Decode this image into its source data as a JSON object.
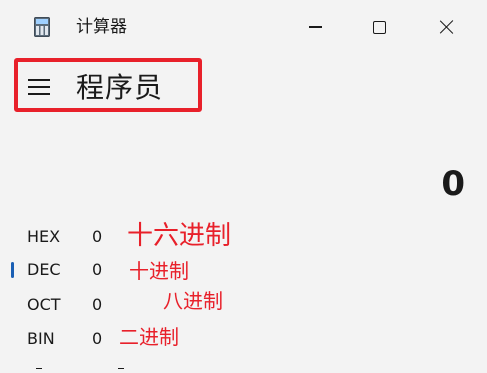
{
  "window": {
    "title": "计算器",
    "icon": "calculator-icon"
  },
  "controls": {
    "minimize_icon": "minimize-icon",
    "maximize_icon": "maximize-icon",
    "close_icon": "close-icon"
  },
  "header": {
    "menu_icon": "hamburger-menu-icon",
    "mode": "程序员",
    "highlight_color": "#e8202a"
  },
  "display": {
    "value": "0"
  },
  "bases": [
    {
      "label": "HEX",
      "value": "0",
      "annotation": "十六进制",
      "selected": false
    },
    {
      "label": "DEC",
      "value": "0",
      "annotation": "十进制",
      "selected": true
    },
    {
      "label": "OCT",
      "value": "0",
      "annotation": "八进制",
      "selected": false
    },
    {
      "label": "BIN",
      "value": "0",
      "annotation": "二进制",
      "selected": false
    }
  ],
  "colors": {
    "background": "#f3f3f3",
    "accent": "#1a5fb4",
    "annotation": "#e8202a"
  }
}
